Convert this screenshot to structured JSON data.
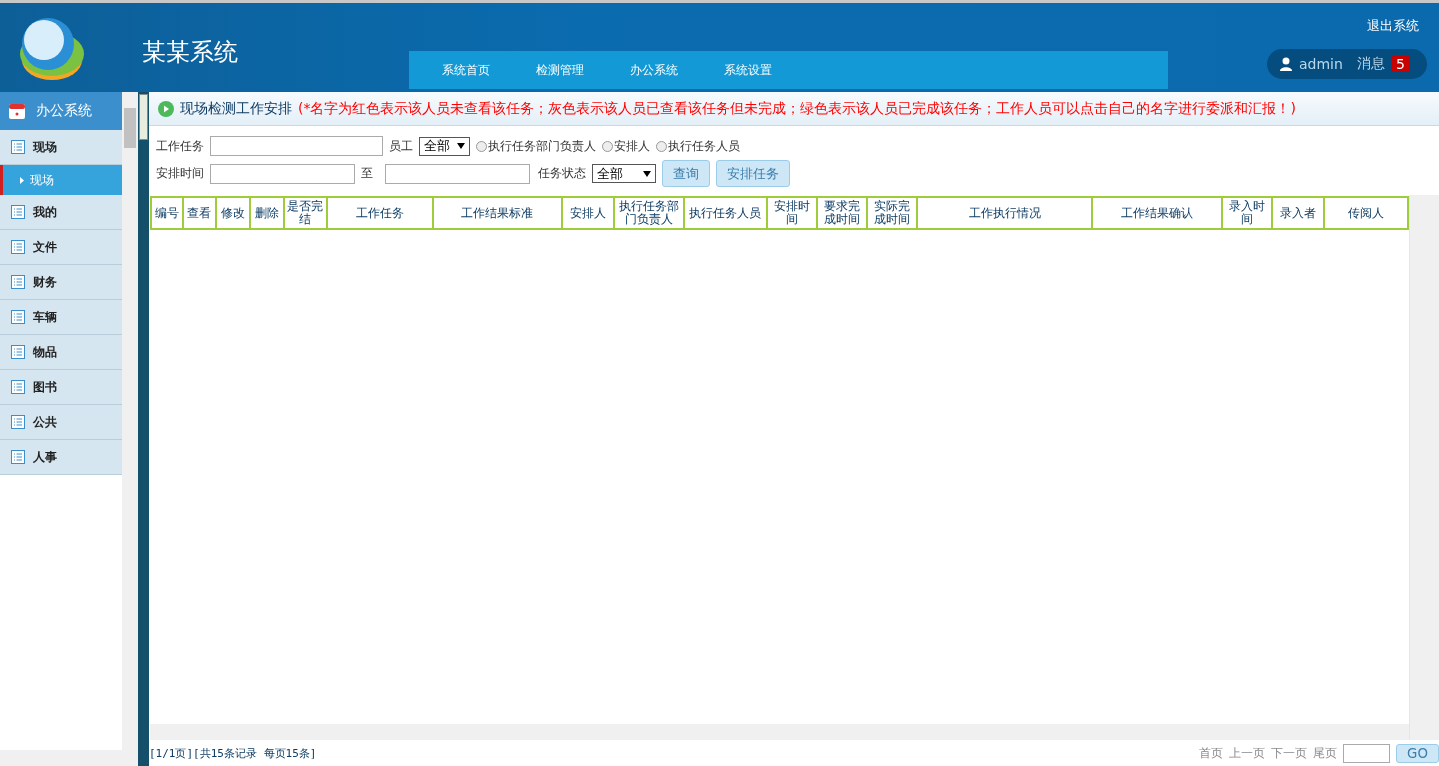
{
  "header": {
    "title": "某某系统",
    "logout": "退出系统",
    "user": "admin",
    "messages_label": "消息",
    "messages_count": "5",
    "nav": [
      {
        "label": "系统首页"
      },
      {
        "label": "检测管理"
      },
      {
        "label": "办公系统"
      },
      {
        "label": "系统设置"
      }
    ]
  },
  "sidebar": {
    "title": "办公系统",
    "items": [
      {
        "label": "现场",
        "children": [
          {
            "label": "现场",
            "selected": true
          }
        ]
      },
      {
        "label": "我的"
      },
      {
        "label": "文件"
      },
      {
        "label": "财务"
      },
      {
        "label": "车辆"
      },
      {
        "label": "物品"
      },
      {
        "label": "图书"
      },
      {
        "label": "公共"
      },
      {
        "label": "人事"
      }
    ]
  },
  "page": {
    "title": "现场检测工作安排",
    "notice": "(*名字为红色表示该人员未查看该任务；灰色表示该人员已查看该任务但未完成；绿色表示该人员已完成该任务；工作人员可以点击自己的名字进行委派和汇报！)"
  },
  "filters": {
    "task_label": "工作任务",
    "employee_label": "员工",
    "employee_value": "全部",
    "roles": [
      {
        "label": "执行任务部门负责人",
        "selected": false
      },
      {
        "label": "安排人",
        "selected": false
      },
      {
        "label": "执行任务人员",
        "selected": false
      }
    ],
    "time_label": "安排时间",
    "to_label": "至",
    "status_label": "任务状态",
    "status_value": "全部",
    "search_button": "查询",
    "assign_button": "安排任务"
  },
  "table": {
    "columns": [
      "编号",
      "查看",
      "修改",
      "删除",
      "是否完结",
      "工作任务",
      "工作结果标准",
      "安排人",
      "执行任务部门负责人",
      "执行任务人员",
      "安排时间",
      "要求完成时间",
      "实际完成时间",
      "工作执行情况",
      "工作结果确认",
      "录入时间",
      "录入者",
      "传阅人"
    ]
  },
  "pagination": {
    "summary": "[1/1页][共15条记录 每页15条]",
    "links": [
      "首页",
      "上一页",
      "下一页",
      "尾页"
    ],
    "go": "GO"
  }
}
